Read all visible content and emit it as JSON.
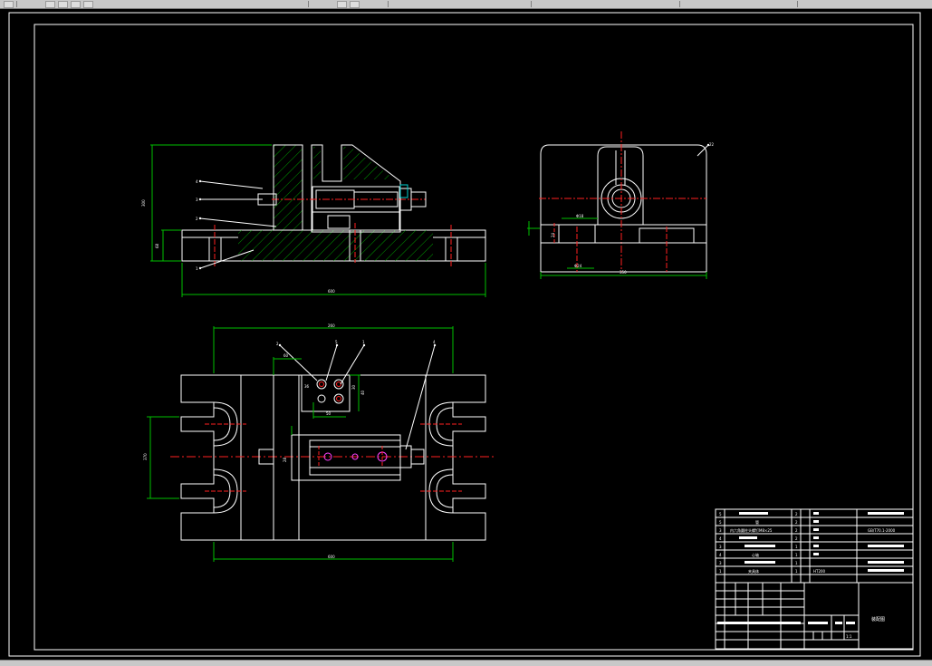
{
  "app": {
    "toolbar_icons": [
      "file-icon",
      "undo-icon",
      "redo-icon",
      "match-properties-icon",
      "zoom-icon",
      "layer-icon"
    ]
  },
  "drawing": {
    "dims": {
      "front_height": "300",
      "front_bottom": "68",
      "front_width": "600",
      "side_width": "350",
      "side_dia_a": "Φ18",
      "side_dia_b": "Φ24",
      "side_small": "24",
      "top_width_top": "260",
      "top_width_bottom": "600",
      "top_height_left": "370",
      "top_dim_a": "60",
      "top_dim_b": "36",
      "top_dim_c": "50",
      "top_dim_d": "30",
      "top_dim_e": "40",
      "top_dim_f": "28"
    },
    "balloons_front": [
      "4",
      "3",
      "2",
      "1"
    ],
    "balloons_top": [
      "2",
      "5",
      "1",
      "4"
    ],
    "side_balloon": "22"
  },
  "title_block": {
    "parts": [
      {
        "no": "5",
        "name": "",
        "qty": "2",
        "material": "",
        "standard": ""
      },
      {
        "no": "5",
        "name": "管",
        "qty": "2",
        "material": "",
        "standard": ""
      },
      {
        "no": "3",
        "name": "内六角圆柱头螺钉M8×25",
        "qty": "2",
        "material": "",
        "standard": "GB/T70.1-2000"
      },
      {
        "no": "4",
        "name": "",
        "qty": "2",
        "material": "",
        "standard": ""
      },
      {
        "no": "3",
        "name": "",
        "qty": "1",
        "material": "",
        "standard": ""
      },
      {
        "no": "4",
        "name": "心轴",
        "qty": "1",
        "material": "",
        "standard": ""
      },
      {
        "no": "3",
        "name": "",
        "qty": "1",
        "material": "",
        "standard": ""
      },
      {
        "no": "1",
        "name": "夹具体",
        "qty": "1",
        "material": "HT200",
        "standard": ""
      }
    ],
    "drawing_title": "装配图",
    "scale": "1:1"
  }
}
